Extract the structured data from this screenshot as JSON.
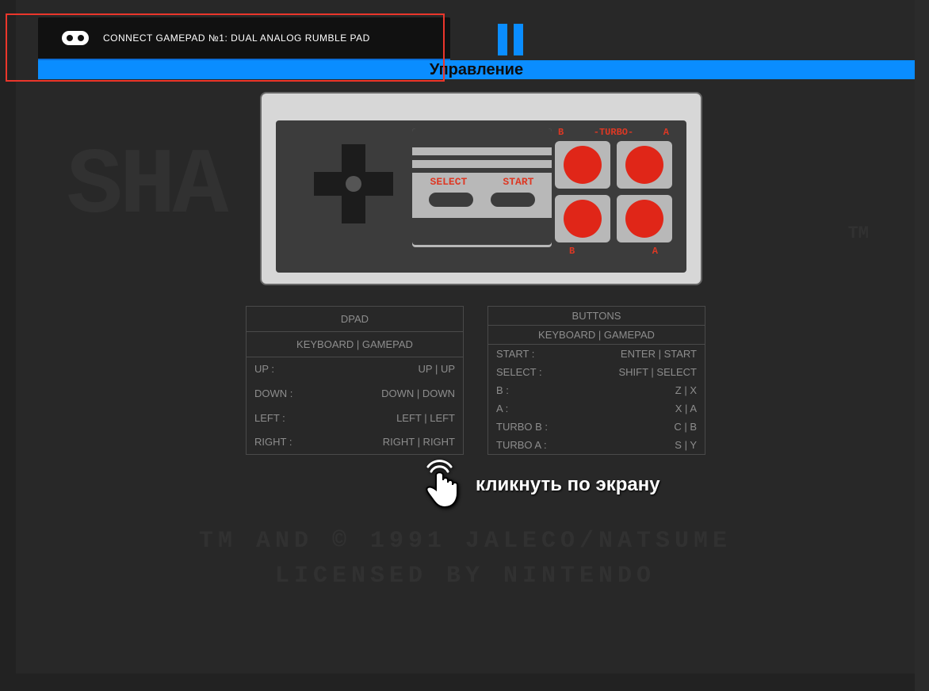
{
  "toast": {
    "text": "CONNECT GAMEPAD №1: DUAL ANALOG RUMBLE PAD"
  },
  "header": {
    "title": "Управление"
  },
  "controller": {
    "select_label": "SELECT",
    "start_label": "START",
    "turbo_b": "B",
    "turbo_mid": "-TURBO-",
    "turbo_a": "A",
    "bottom_b": "B",
    "bottom_a": "A"
  },
  "tables": {
    "dpad": {
      "title": "DPAD",
      "subtitle": "KEYBOARD | GAMEPAD",
      "rows": [
        {
          "k": "UP :",
          "v": "UP | UP"
        },
        {
          "k": "DOWN :",
          "v": "DOWN | DOWN"
        },
        {
          "k": "LEFT :",
          "v": "LEFT | LEFT"
        },
        {
          "k": "RIGHT :",
          "v": "RIGHT | RIGHT"
        }
      ]
    },
    "buttons": {
      "title": "BUTTONS",
      "subtitle": "KEYBOARD | GAMEPAD",
      "rows": [
        {
          "k": "START :",
          "v": "ENTER | START"
        },
        {
          "k": "SELECT :",
          "v": "SHIFT | SELECT"
        },
        {
          "k": "B :",
          "v": "Z | X"
        },
        {
          "k": "A :",
          "v": "X | A"
        },
        {
          "k": "TURBO B :",
          "v": "C | B"
        },
        {
          "k": "TURBO A :",
          "v": "S | Y"
        }
      ]
    }
  },
  "instruction": {
    "text": "кликнуть по экрану"
  },
  "background": {
    "title": "SHA    ND",
    "tm": "TM",
    "line1": "TM AND © 1991 JALECO/NATSUME",
    "line2": "LICENSED BY NINTENDO"
  }
}
